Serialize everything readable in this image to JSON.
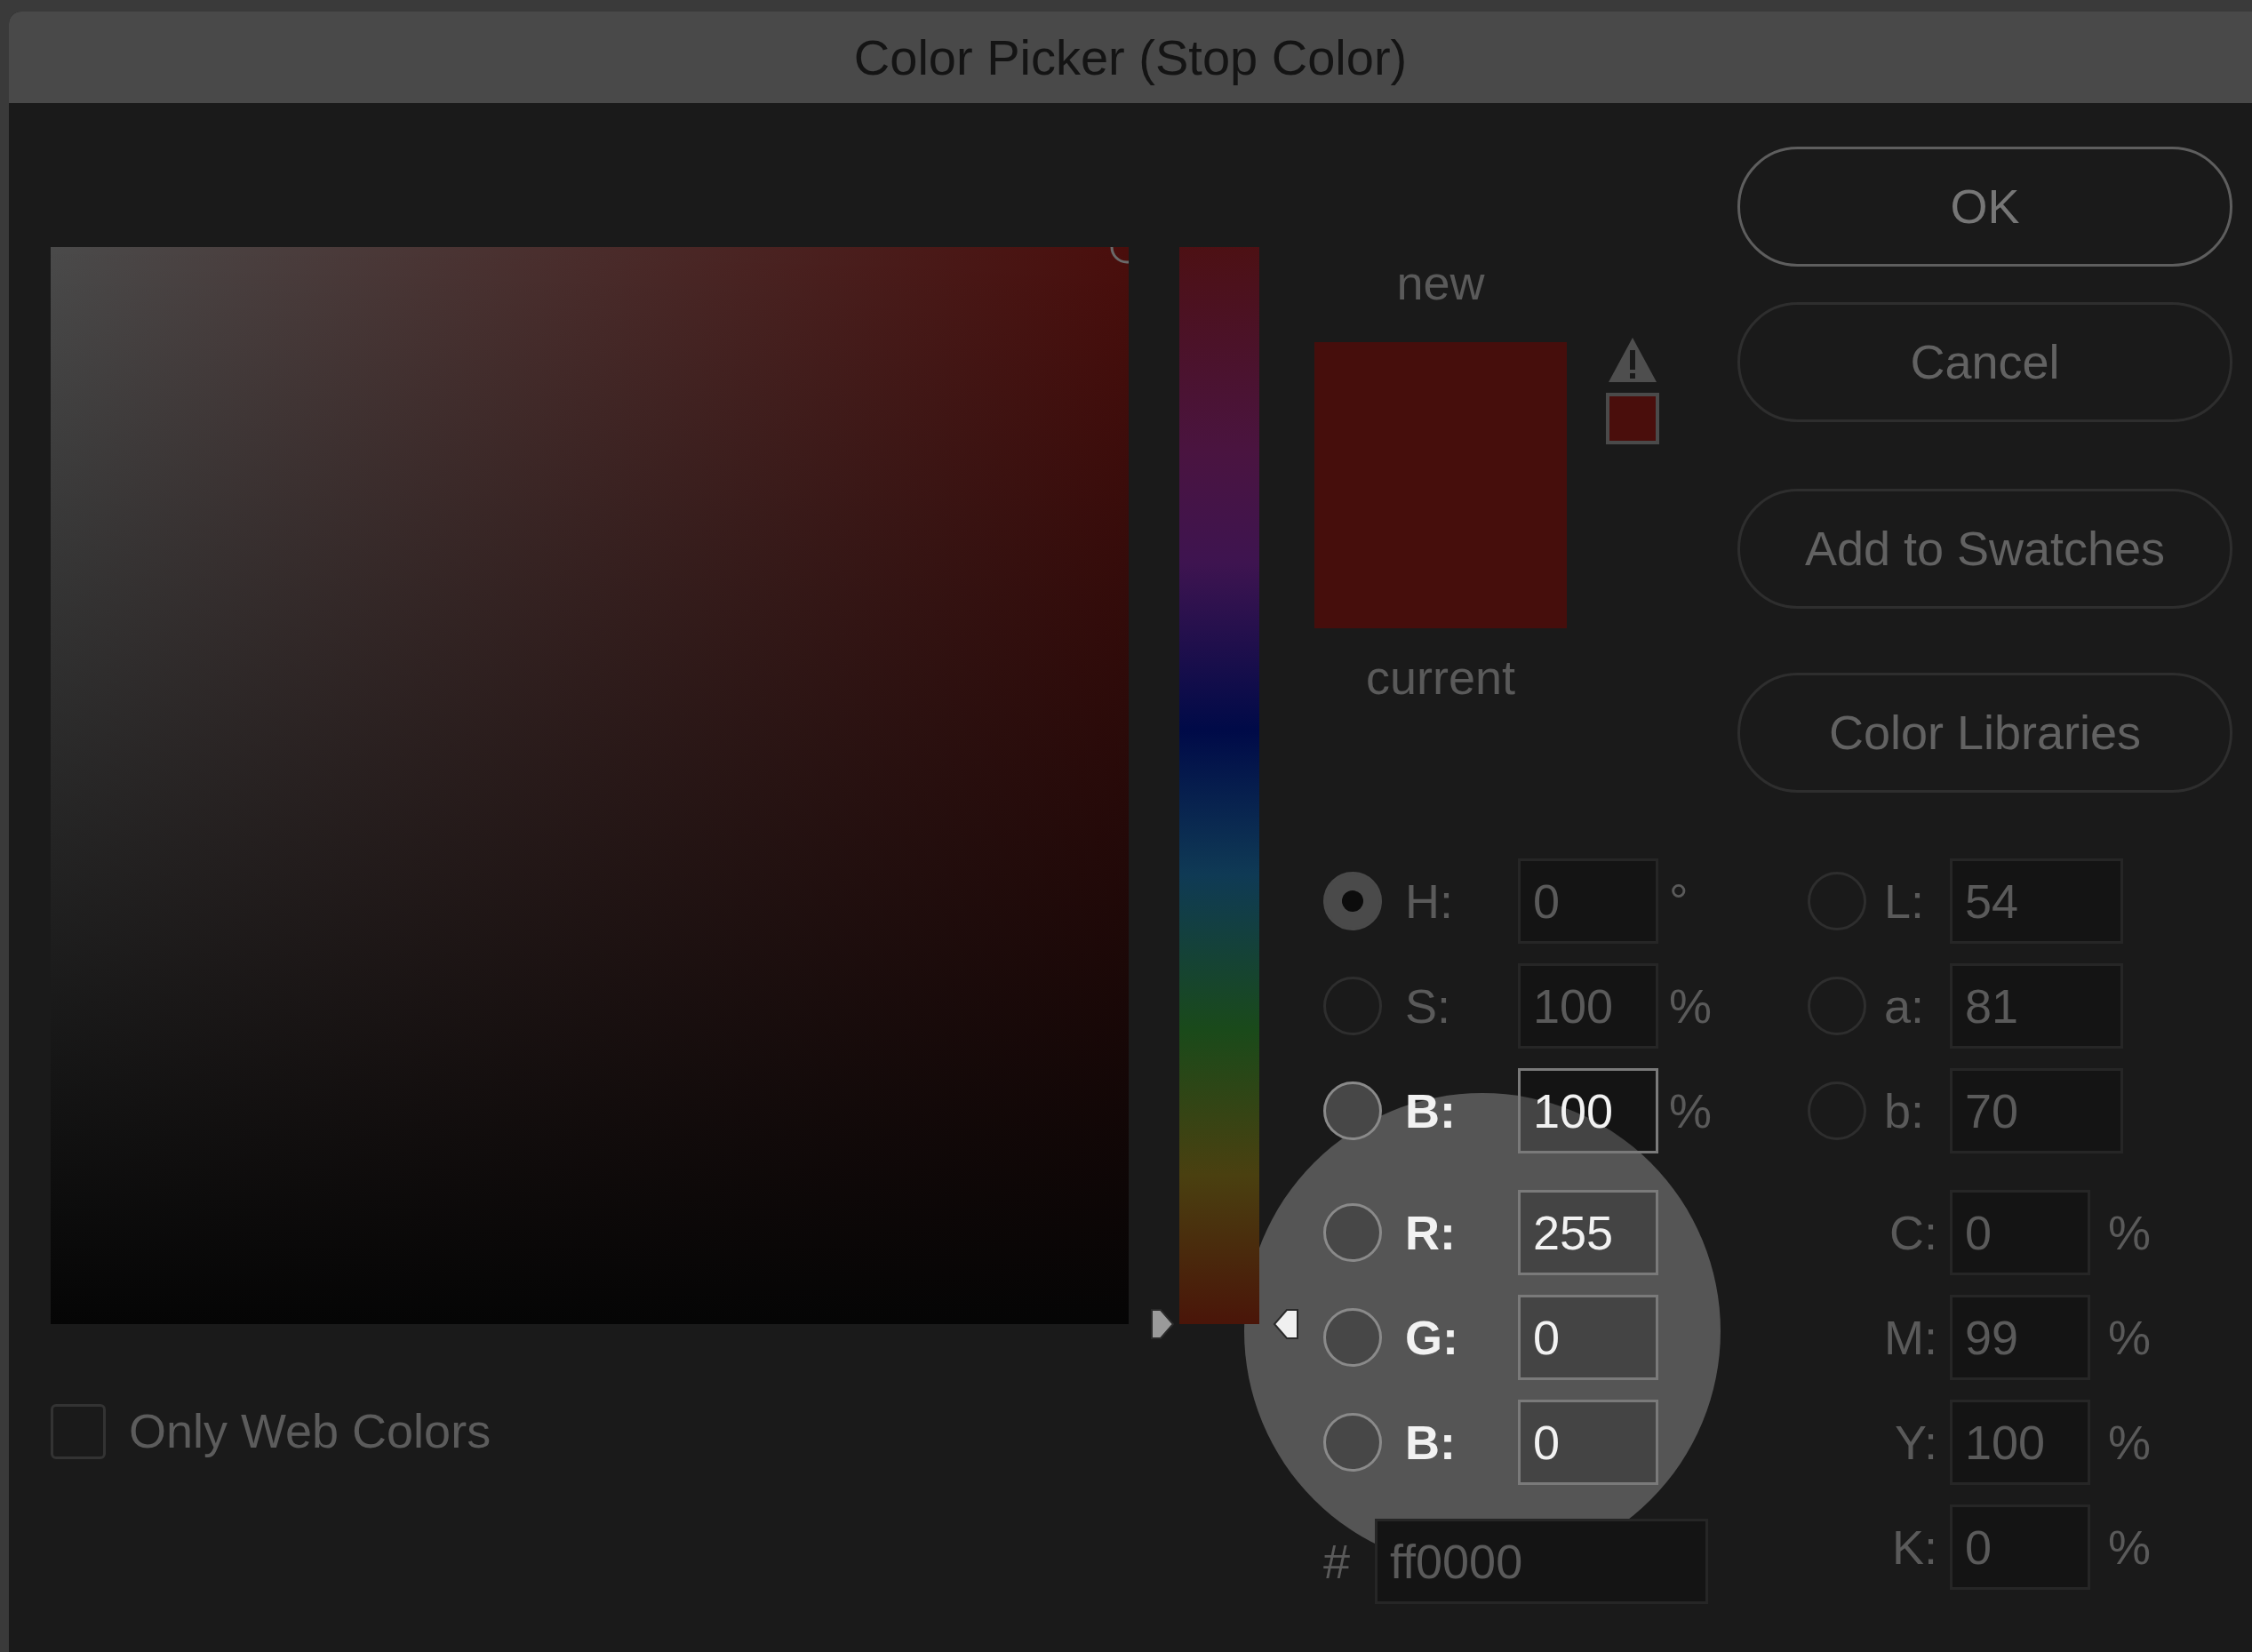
{
  "window": {
    "title": "Color Picker (Stop Color)"
  },
  "hue_slider": {
    "level": 0
  },
  "preview": {
    "new_label": "new",
    "current_label": "current",
    "out_of_gamut_warning": true
  },
  "buttons": [
    {
      "label": "OK",
      "default": true
    },
    {
      "label": "Cancel",
      "default": false
    },
    {
      "label": "Add to Swatches",
      "default": false
    },
    {
      "label": "Color Libraries",
      "default": false
    }
  ],
  "hsb": [
    {
      "label": "H:",
      "value": "0",
      "unit": "°",
      "selected": true,
      "highlighted": false
    },
    {
      "label": "S:",
      "value": "100",
      "unit": "%",
      "selected": false,
      "highlighted": false
    },
    {
      "label": "B:",
      "value": "100",
      "unit": "%",
      "selected": false,
      "highlighted": true
    }
  ],
  "rgb": [
    {
      "label": "R:",
      "value": "255",
      "selected": false,
      "highlighted": true
    },
    {
      "label": "G:",
      "value": "0",
      "selected": false,
      "highlighted": true
    },
    {
      "label": "B:",
      "value": "0",
      "selected": false,
      "highlighted": true
    }
  ],
  "hex": {
    "label": "#",
    "value": "ff0000"
  },
  "lab": [
    {
      "label": "L:",
      "value": "54",
      "selected": false
    },
    {
      "label": "a:",
      "value": "81",
      "selected": false
    },
    {
      "label": "b:",
      "value": "70",
      "selected": false
    }
  ],
  "cmyk": [
    {
      "label": "C:",
      "value": "0",
      "unit": "%"
    },
    {
      "label": "M:",
      "value": "99",
      "unit": "%"
    },
    {
      "label": "Y:",
      "value": "100",
      "unit": "%"
    },
    {
      "label": "K:",
      "value": "0",
      "unit": "%"
    }
  ],
  "only_web_colors": {
    "label": "Only Web Colors",
    "checked": false
  },
  "spotlight": true
}
